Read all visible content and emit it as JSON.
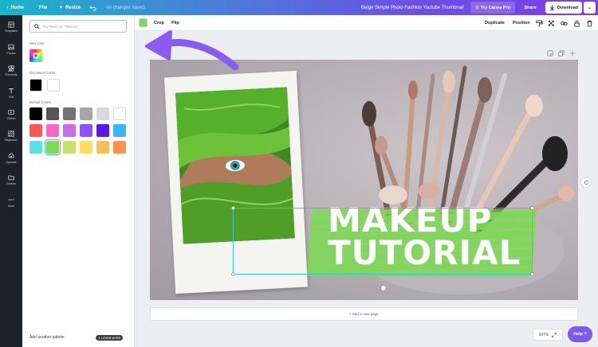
{
  "topbar": {
    "home": "Home",
    "file": "File",
    "resize": "Resize",
    "saved_status": "All changes saved",
    "doc_title": "Beige Simple Photo Fashion Youtube Thumbnail",
    "try_pro": "Try Canva Pro",
    "share": "Share",
    "download": "Download"
  },
  "rail": [
    {
      "icon": "templates-icon",
      "label": "Templates"
    },
    {
      "icon": "photos-icon",
      "label": "Photos"
    },
    {
      "icon": "elements-icon",
      "label": "Elements"
    },
    {
      "icon": "text-icon",
      "label": "Text"
    },
    {
      "icon": "videos-icon",
      "label": "Videos"
    },
    {
      "icon": "background-icon",
      "label": "Bkground"
    },
    {
      "icon": "uploads-icon",
      "label": "Uploads"
    },
    {
      "icon": "folders-icon",
      "label": "Folders"
    },
    {
      "icon": "more-icon",
      "label": "More"
    }
  ],
  "panel": {
    "search_placeholder": "Try \"blue\" or \"#00c4cc\"",
    "new_color": "New color",
    "document_colors_label": "Document Colors",
    "document_colors": [
      "#000000",
      "#ffffff"
    ],
    "default_colors_label": "Default Colors",
    "default_colors": [
      "#000000",
      "#545454",
      "#737373",
      "#a6a6a6",
      "#d9d9d9",
      "#ffffff",
      "#ff5757",
      "#ff66c4",
      "#cb6ce6",
      "#8c52ff",
      "#5e17eb",
      "#38b6ff",
      "#5ce1e6",
      "#7ed957",
      "#c9e265",
      "#ffde59",
      "#ffbd59",
      "#ff914d"
    ],
    "selected_color": "#7ed957",
    "add_palette": "Add another palette",
    "learn_more": "LEARN MORE"
  },
  "toolbar": {
    "swatch_color": "#7ed957",
    "crop": "Crop",
    "flip": "Flip",
    "duplicate": "Duplicate",
    "position": "Position"
  },
  "design": {
    "headline_1": "MAKEUP",
    "headline_2": "TUTORIAL",
    "accent_color": "#7ed957"
  },
  "canvas": {
    "add_page": "+ Add a new page",
    "zoom": "107%",
    "help": "Help ?"
  }
}
